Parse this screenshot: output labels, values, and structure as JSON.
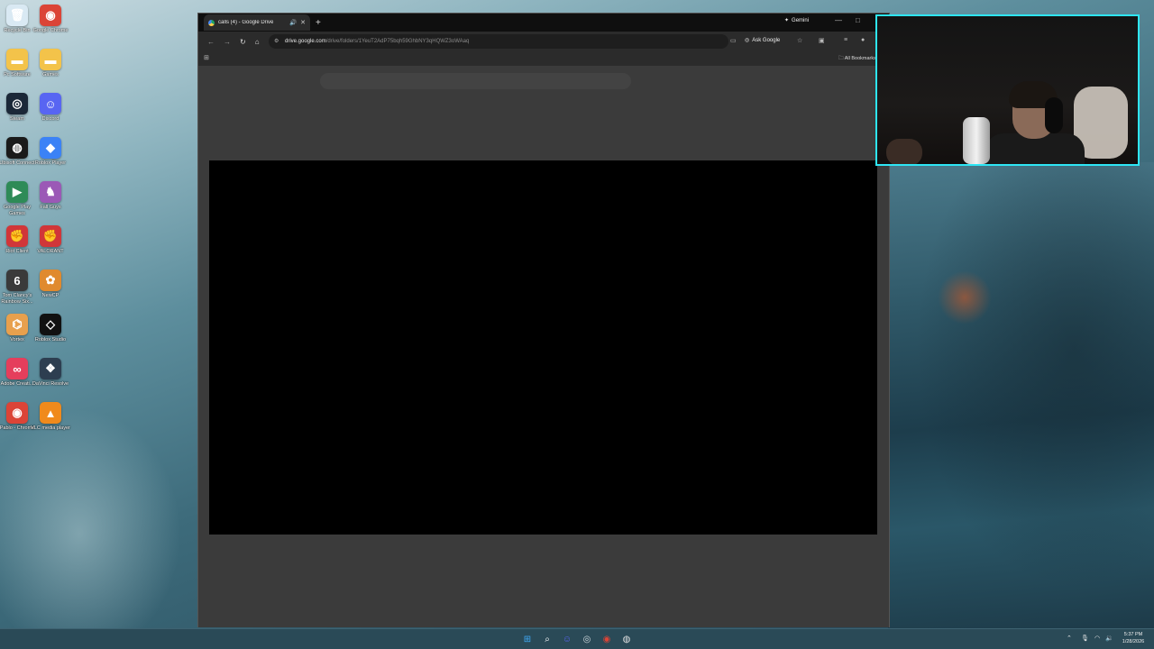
{
  "desktop": {
    "icons": [
      {
        "label": "Recycle Bin",
        "icon": "recycle-bin-icon",
        "color": "#d9e9f3"
      },
      {
        "label": "Google Chrome",
        "icon": "chrome-icon",
        "color": "#db4437"
      },
      {
        "label": "Pc Software",
        "icon": "folder-icon",
        "color": "#f3c34a"
      },
      {
        "label": "Games",
        "icon": "folder-icon",
        "color": "#f3c34a"
      },
      {
        "label": "Steam",
        "icon": "steam-icon",
        "color": "#1b2838"
      },
      {
        "label": "Discord",
        "icon": "discord-icon",
        "color": "#5865f2"
      },
      {
        "label": "Ubisoft Connect",
        "icon": "ubisoft-icon",
        "color": "#1a1a1a"
      },
      {
        "label": "Roblox Player",
        "icon": "roblox-player-icon",
        "color": "#3b82f6"
      },
      {
        "label": "Google Play Games",
        "icon": "google-play-games-icon",
        "color": "#2e8b57"
      },
      {
        "label": "Fall Guys",
        "icon": "fall-guys-icon",
        "color": "#9b59b6"
      },
      {
        "label": "Riot Client",
        "icon": "riot-client-icon",
        "color": "#d13639"
      },
      {
        "label": "VALORANT",
        "icon": "valorant-icon",
        "color": "#d13639"
      },
      {
        "label": "Tom Clancy's Rainbow Six...",
        "icon": "rainbow-six-icon",
        "color": "#3a3a3a"
      },
      {
        "label": "NewCP",
        "icon": "newcp-icon",
        "color": "#e08a2e"
      },
      {
        "label": "Vortex",
        "icon": "vortex-icon",
        "color": "#e8a04d"
      },
      {
        "label": "Roblox Studio",
        "icon": "roblox-studio-icon",
        "color": "#111111"
      },
      {
        "label": "Adobe Creati...",
        "icon": "adobe-creative-cloud-icon",
        "color": "#e53e5c"
      },
      {
        "label": "DaVinci Resolve",
        "icon": "davinci-resolve-icon",
        "color": "#2d3e50"
      },
      {
        "label": "Pablo - Chrome",
        "icon": "chrome-icon",
        "color": "#db4437"
      },
      {
        "label": "VLC media player",
        "icon": "vlc-icon",
        "color": "#f08a1c"
      }
    ]
  },
  "browser": {
    "tab_title": "calls (4) - Google Drive",
    "new_tab": "+",
    "gemini_label": "Gemini",
    "url_host": "drive.google.com",
    "url_path": "/drive/folders/1YeuT2AdP75bqh59GhbNY3qHQWZ3oWAaq",
    "ask_google": "Ask Google",
    "all_bookmarks": "All Bookmarks"
  },
  "taskbar": {
    "apps": [
      {
        "icon": "windows-start-icon",
        "color": "#3fa9f5"
      },
      {
        "icon": "search-icon",
        "color": "#ffffff"
      },
      {
        "icon": "discord-icon",
        "color": "#5865f2"
      },
      {
        "icon": "steam-icon",
        "color": "#cfd8dc"
      },
      {
        "icon": "chrome-icon",
        "color": "#db4437"
      },
      {
        "icon": "obs-icon",
        "color": "#e0e0e0"
      }
    ],
    "time": "5:37 PM",
    "date": "1/28/2026"
  },
  "colors": {
    "webcam_border": "#2ee6f5",
    "player_bg": "#000000"
  }
}
